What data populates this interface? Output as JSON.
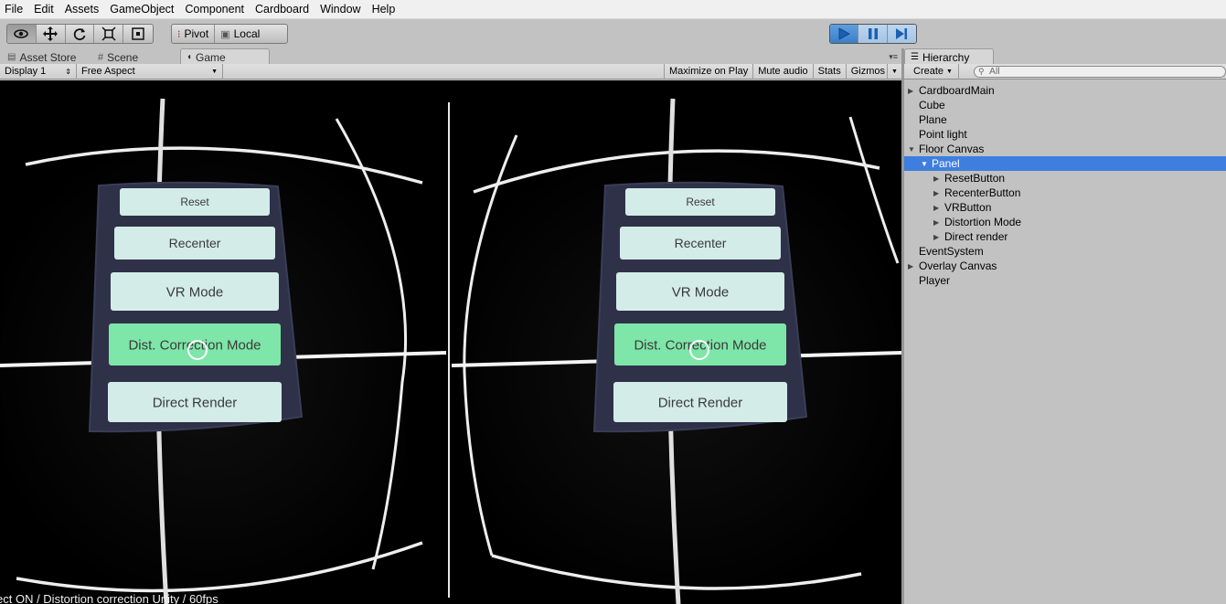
{
  "menu": [
    "File",
    "Edit",
    "Assets",
    "GameObject",
    "Component",
    "Cardboard",
    "Window",
    "Help"
  ],
  "toolbar": {
    "transform_tools": [
      "hand-icon",
      "move-icon",
      "rotate-icon",
      "scale-icon",
      "rect-icon"
    ],
    "pivot_label": "Pivot",
    "local_label": "Local"
  },
  "tabs": {
    "asset_store": "Asset Store",
    "scene": "Scene",
    "game": "Game"
  },
  "game_toolbar": {
    "display": "Display 1",
    "aspect": "Free Aspect",
    "maximize": "Maximize on Play",
    "mute": "Mute audio",
    "stats": "Stats",
    "gizmos": "Gizmos"
  },
  "game_view": {
    "buttons": [
      "Reset",
      "Recenter",
      "VR Mode",
      "Dist. Correction Mode",
      "Direct Render"
    ],
    "status_text": "ect ON / Distortion correction Unity / 60fps",
    "highlight_color": "#7ee6a8",
    "button_color": "#d3ece8",
    "panel_color": "#2f3148"
  },
  "hierarchy": {
    "tab_label": "Hierarchy",
    "create_label": "Create",
    "search_placeholder": "All",
    "items": [
      {
        "label": "CardboardMain",
        "depth": 0,
        "arrow": "right"
      },
      {
        "label": "Cube",
        "depth": 0,
        "arrow": ""
      },
      {
        "label": "Plane",
        "depth": 0,
        "arrow": ""
      },
      {
        "label": "Point light",
        "depth": 0,
        "arrow": ""
      },
      {
        "label": "Floor Canvas",
        "depth": 0,
        "arrow": "down"
      },
      {
        "label": "Panel",
        "depth": 1,
        "arrow": "down",
        "selected": true
      },
      {
        "label": "ResetButton",
        "depth": 2,
        "arrow": "right"
      },
      {
        "label": "RecenterButton",
        "depth": 2,
        "arrow": "right"
      },
      {
        "label": "VRButton",
        "depth": 2,
        "arrow": "right"
      },
      {
        "label": "Distortion Mode",
        "depth": 2,
        "arrow": "right"
      },
      {
        "label": "Direct render",
        "depth": 2,
        "arrow": "right"
      },
      {
        "label": "EventSystem",
        "depth": 0,
        "arrow": ""
      },
      {
        "label": "Overlay Canvas",
        "depth": 0,
        "arrow": "right"
      },
      {
        "label": "Player",
        "depth": 0,
        "arrow": ""
      }
    ]
  }
}
